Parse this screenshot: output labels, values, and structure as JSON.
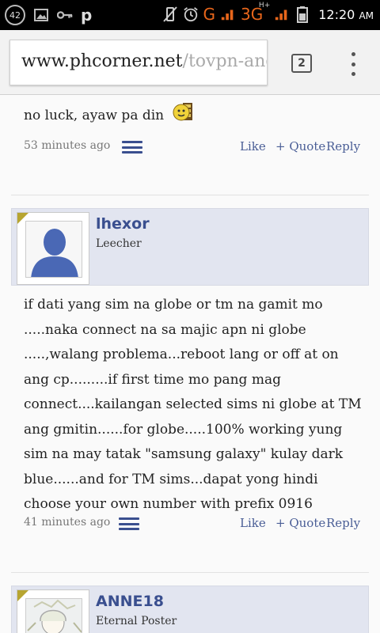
{
  "status_bar": {
    "notification_count": "42",
    "time": "12:20",
    "ampm": "AM",
    "network_g": "G",
    "network_3g": "3G",
    "network_3g_sup": "H+"
  },
  "browser": {
    "url_host": "www.phcorner.net",
    "url_path": "/tovpn-and",
    "tab_count": "2"
  },
  "posts": [
    {
      "text": "no luck, ayaw pa din",
      "time": "53 minutes ago",
      "like": "Like",
      "quote": "+ Quote",
      "reply": "Reply"
    },
    {
      "username": "lhexor",
      "user_title": "Leecher",
      "text": "if dati yang sim na globe or tm na gamit mo .....naka connect na sa majic apn ni globe .....,walang problema...reboot lang or off at on ang cp.........if first time mo pang mag connect....kailangan selected sims ni globe at TM ang gmitin......for globe.....100% working yung sim na may tatak \"samsung galaxy\" kulay dark blue......and for TM sims...dapat yong hindi choose your own number with prefix 0916",
      "time": "41 minutes ago",
      "like": "Like",
      "quote": "+ Quote",
      "reply": "Reply"
    },
    {
      "username": "ANNE18",
      "user_title": "Eternal Poster"
    }
  ]
}
